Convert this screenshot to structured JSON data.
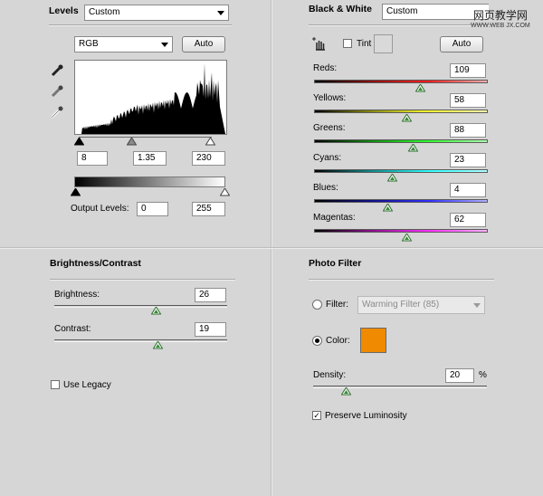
{
  "levels": {
    "title": "Levels",
    "preset": "Custom",
    "channel": "RGB",
    "auto_label": "Auto",
    "input_black": "8",
    "input_gamma": "1.35",
    "input_white": "230",
    "output_label": "Output Levels:",
    "output_black": "0",
    "output_white": "255"
  },
  "black_white": {
    "title": "Black & White",
    "preset": "Custom",
    "tint_label": "Tint",
    "auto_label": "Auto",
    "sliders": [
      {
        "label": "Reds:",
        "value": "109",
        "pos": 0.61
      },
      {
        "label": "Yellows:",
        "value": "58",
        "pos": 0.53
      },
      {
        "label": "Greens:",
        "value": "88",
        "pos": 0.57
      },
      {
        "label": "Cyans:",
        "value": "23",
        "pos": 0.45
      },
      {
        "label": "Blues:",
        "value": "4",
        "pos": 0.42
      },
      {
        "label": "Magentas:",
        "value": "62",
        "pos": 0.53
      }
    ]
  },
  "brightness_contrast": {
    "title": "Brightness/Contrast",
    "brightness_label": "Brightness:",
    "brightness_value": "26",
    "contrast_label": "Contrast:",
    "contrast_value": "19",
    "legacy_label": "Use Legacy"
  },
  "photo_filter": {
    "title": "Photo Filter",
    "filter_label": "Filter:",
    "filter_value": "Warming Filter (85)",
    "color_label": "Color:",
    "color_swatch": "#f08a00",
    "density_label": "Density:",
    "density_value": "20",
    "density_unit": "%",
    "preserve_label": "Preserve Luminosity"
  },
  "watermark": {
    "line1": "网页教学网",
    "line2": "WWW.WEB JX.COM"
  }
}
